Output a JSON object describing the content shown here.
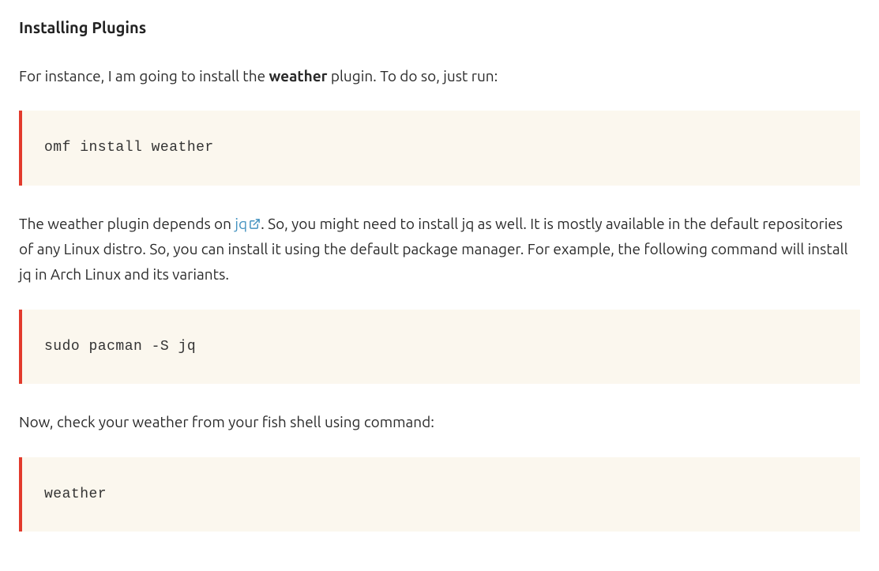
{
  "heading": "Installing Plugins",
  "para1": {
    "pre": "For instance, I am going to install the ",
    "bold": "weather",
    "post": " plugin. To do so, just run:"
  },
  "code1": "omf install weather",
  "para2": {
    "pre": "The weather plugin depends on ",
    "link_text": "jq",
    "link_icon_name": "external-link-icon",
    "post": ". So, you might need to install jq as well. It is mostly available in the default repositories of any Linux distro. So, you can install it using the default package manager. For example, the following command will install jq in Arch Linux and its variants."
  },
  "code2": "sudo pacman -S jq",
  "para3": "Now, check your weather from your fish shell using command:",
  "code3": "weather",
  "colors": {
    "code_bg": "#fbf7ee",
    "accent_border": "#e23a2c",
    "link": "#4593c0"
  }
}
